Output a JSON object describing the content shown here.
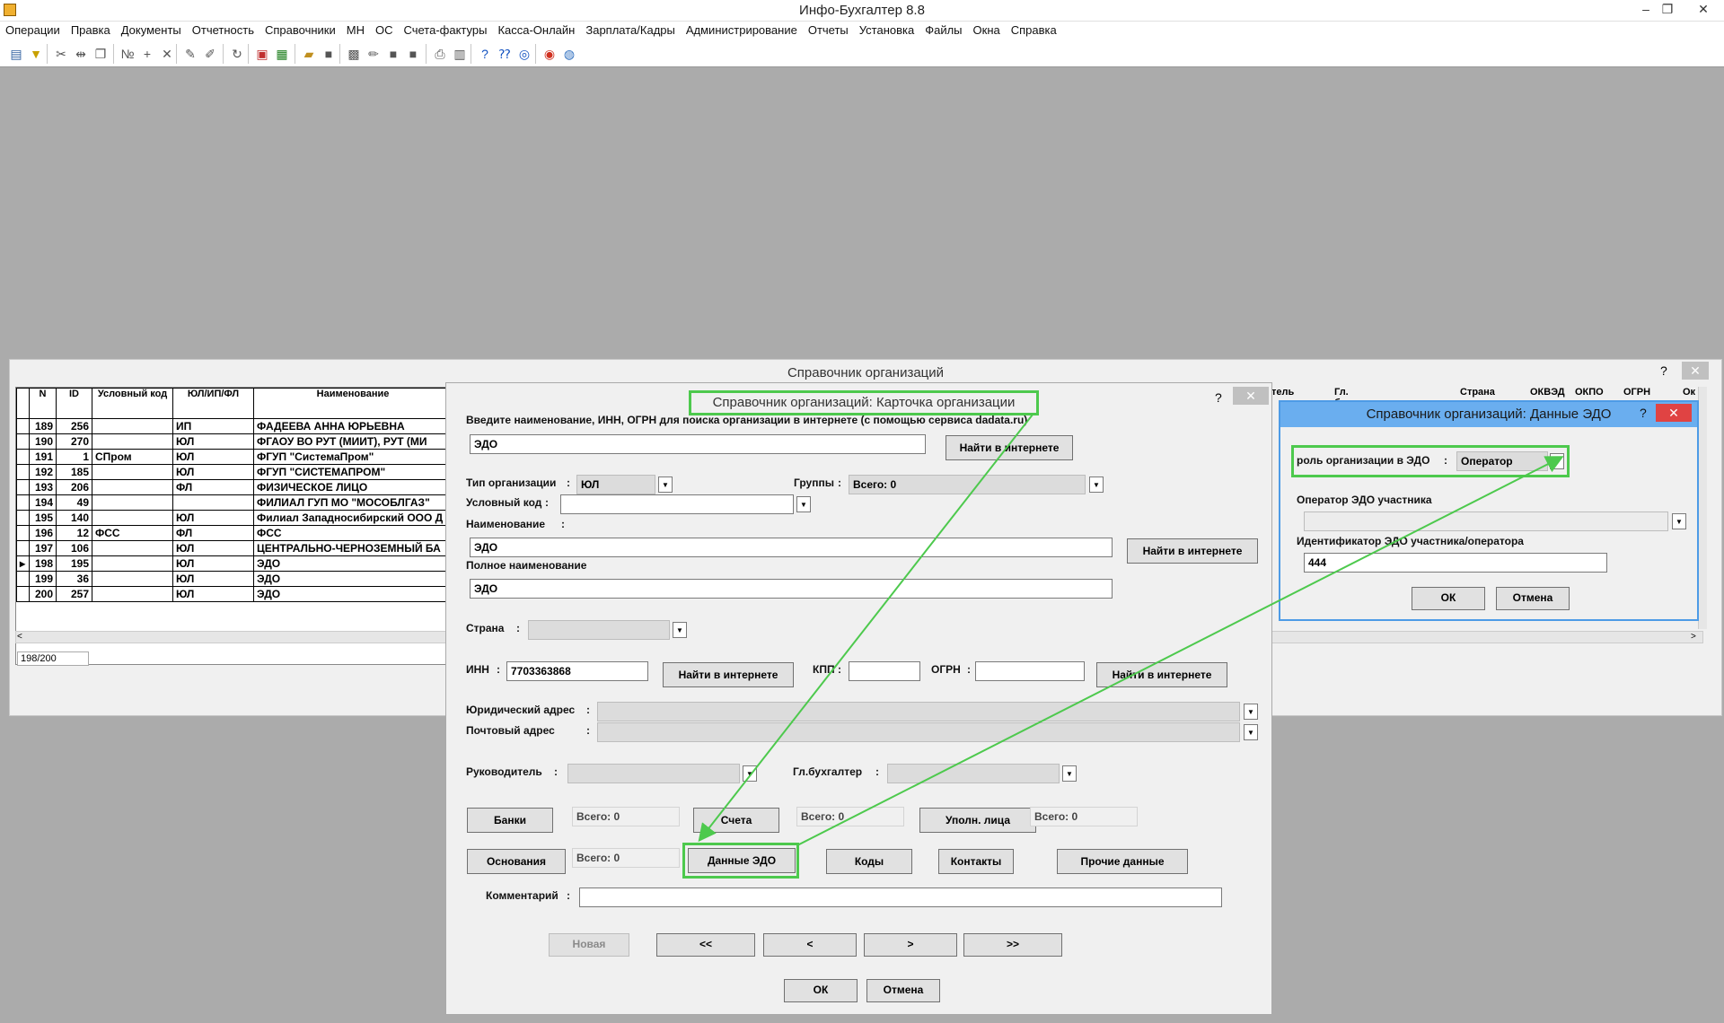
{
  "app": {
    "title": "Инфо-Бухгалтер 8.8",
    "minimize": "–",
    "restore": "❐",
    "close": "✕"
  },
  "menu": [
    "Операции",
    "Правка",
    "Документы",
    "Отчетность",
    "Справочники",
    "МН",
    "ОС",
    "Счета-фактуры",
    "Касса-Онлайн",
    "Зарплата/Кадры",
    "Администрирование",
    "Отчеты",
    "Установка",
    "Файлы",
    "Окна",
    "Справка"
  ],
  "toolbar_icons": [
    "sheet-icon",
    "filter-icon",
    "cut-icon",
    "split-icon",
    "copy-icon",
    "numbering-icon",
    "add-icon",
    "delete-icon",
    "mark-icon",
    "unmark-icon",
    "refresh-icon",
    "pdf-icon",
    "excel-icon",
    "open-folder-icon",
    "save-icon",
    "image-icon",
    "edit-icon",
    "square-icon",
    "square2-icon",
    "print-icon",
    "calc-icon",
    "help-icon",
    "context-help-icon",
    "compass-icon",
    "lifebuoy-icon",
    "globe-icon"
  ],
  "org_list": {
    "title": "Справочник организаций",
    "help": "?",
    "close": "✕",
    "columns": {
      "n": "N",
      "id": "ID",
      "code": "Условный код",
      "type": "ЮЛ/ИП/ФЛ",
      "name": "Наименование"
    },
    "right_columns": [
      "тель",
      "Гл. бухгалтер",
      "Страна",
      "ОКВЭД",
      "ОКПО",
      "ОГРН",
      "Ок"
    ],
    "rows": [
      {
        "n": "189",
        "id": "256",
        "code": "",
        "type": "ИП",
        "name": "ФАДЕЕВА АННА ЮРЬЕВНА"
      },
      {
        "n": "190",
        "id": "270",
        "code": "",
        "type": "ЮЛ",
        "name": "ФГАОУ ВО РУТ (МИИТ), РУТ (МИ"
      },
      {
        "n": "191",
        "id": "1",
        "code": "СПром",
        "type": "ЮЛ",
        "name": "ФГУП \"СистемаПром\""
      },
      {
        "n": "192",
        "id": "185",
        "code": "",
        "type": "ЮЛ",
        "name": "ФГУП \"СИСТЕМАПРОМ\""
      },
      {
        "n": "193",
        "id": "206",
        "code": "",
        "type": "ФЛ",
        "name": "ФИЗИЧЕСКОЕ ЛИЦО"
      },
      {
        "n": "194",
        "id": "49",
        "code": "",
        "type": "",
        "name": "ФИЛИАЛ ГУП МО \"МОСОБЛГАЗ\""
      },
      {
        "n": "195",
        "id": "140",
        "code": "",
        "type": "ЮЛ",
        "name": "Филиал Западносибирский ООО Д"
      },
      {
        "n": "196",
        "id": "12",
        "code": "ФСС",
        "type": "ФЛ",
        "name": "ФСС"
      },
      {
        "n": "197",
        "id": "106",
        "code": "",
        "type": "ЮЛ",
        "name": "ЦЕНТРАЛЬНО-ЧЕРНОЗЕМНЫЙ БА"
      },
      {
        "n": "198",
        "id": "195",
        "code": "",
        "type": "ЮЛ",
        "name": "ЭДО"
      },
      {
        "n": "199",
        "id": "36",
        "code": "",
        "type": "ЮЛ",
        "name": "ЭДО"
      },
      {
        "n": "200",
        "id": "257",
        "code": "",
        "type": "ЮЛ",
        "name": "ЭДО"
      }
    ],
    "current_marker": "▸",
    "status": "198/200"
  },
  "card": {
    "title": "Справочник организаций: Карточка организации",
    "help": "?",
    "close": "✕",
    "search_hint": "Введите наименование, ИНН, ОГРН для поиска организации в интернете (с помощью сервиса dadata.ru)",
    "search_value": "ЭДО",
    "find_label": "Найти в интернете",
    "org_type_label": "Тип организации",
    "org_type_value": "ЮЛ",
    "groups_label": "Группы",
    "groups_value": "Всего: 0",
    "code_label": "Условный код",
    "name_label": "Наименование",
    "name_value": "ЭДО",
    "fullname_label": "Полное наименование",
    "fullname_value": "ЭДО",
    "country_label": "Страна",
    "inn_label": "ИНН",
    "inn_value": "7703363868",
    "kpp_label": "КПП",
    "ogrn_label": "ОГРН",
    "legal_addr_label": "Юридический адрес",
    "post_addr_label": "Почтовый адрес",
    "head_label": "Руководитель",
    "accountant_label": "Гл.бухгалтер",
    "banks": "Банки",
    "accounts": "Счета",
    "reps": "Уполн. лица",
    "total0": "Всего: 0",
    "bases": "Основания",
    "edo": "Данные ЭДО",
    "codes": "Коды",
    "contacts": "Контакты",
    "other": "Прочие данные",
    "comment_label": "Комментарий",
    "new": "Новая",
    "first": "<<",
    "prev": "<",
    "next": ">",
    "last": ">>",
    "ok": "ОК",
    "cancel": "Отмена",
    "colon": ":"
  },
  "edo": {
    "title": "Справочник организаций: Данные ЭДО",
    "help": "?",
    "close": "✕",
    "role_label": "роль организации в ЭДО",
    "role_value": "Оператор",
    "operator_label": "Оператор ЭДО участника",
    "id_label": "Идентификатор ЭДО участника/оператора",
    "id_value": "444",
    "ok": "ОК",
    "cancel": "Отмена"
  },
  "colors": {
    "highlight": "#4dc94d",
    "edo_border": "#4d9be6",
    "close_red": "#e04343"
  }
}
